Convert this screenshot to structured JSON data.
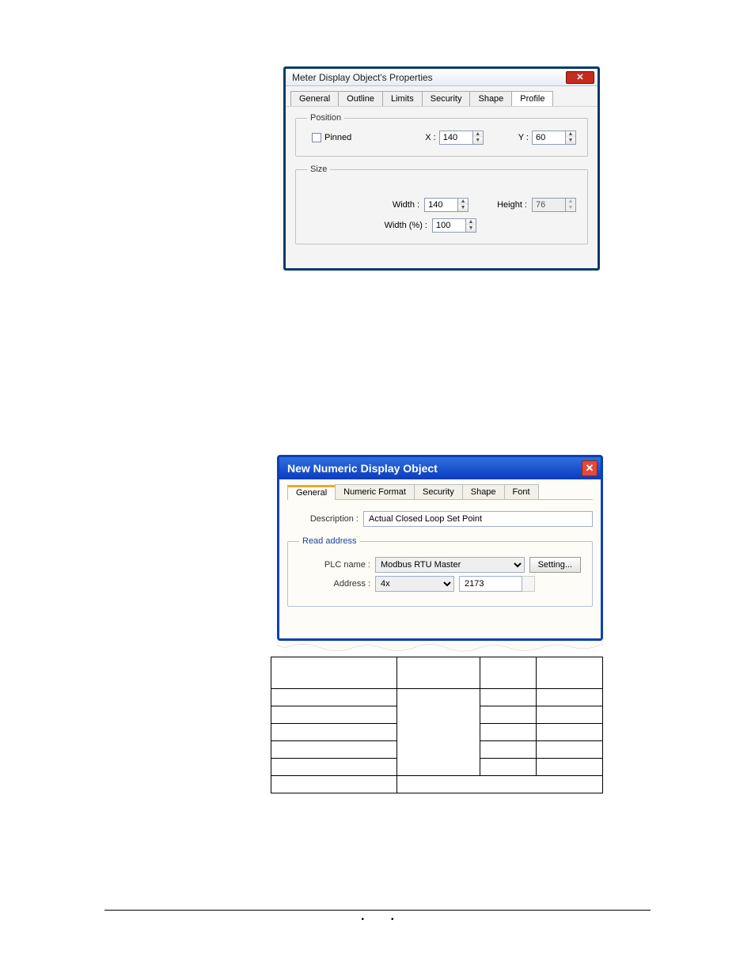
{
  "dialog1": {
    "title": "Meter Display Object's Properties",
    "tabs": [
      "General",
      "Outline",
      "Limits",
      "Security",
      "Shape",
      "Profile"
    ],
    "active_tab": "Profile",
    "position": {
      "legend": "Position",
      "pinned_label": "Pinned",
      "x_label": "X :",
      "x_value": "140",
      "y_label": "Y :",
      "y_value": "60"
    },
    "size": {
      "legend": "Size",
      "width_label": "Width :",
      "width_value": "140",
      "height_label": "Height :",
      "height_value": "76",
      "widthpct_label": "Width (%) :",
      "widthpct_value": "100"
    }
  },
  "dialog2": {
    "title": "New  Numeric Display Object",
    "tabs": [
      "General",
      "Numeric Format",
      "Security",
      "Shape",
      "Font"
    ],
    "active_tab": "General",
    "desc_label": "Description :",
    "desc_value": "Actual Closed Loop Set Point",
    "read_address": {
      "legend": "Read address",
      "plc_label": "PLC name :",
      "plc_value": "Modbus RTU Master",
      "setting_btn": "Setting...",
      "addr_label": "Address :",
      "addr_type": "4x",
      "addr_value": "2173"
    }
  },
  "footer": {
    "bullet": "•"
  }
}
